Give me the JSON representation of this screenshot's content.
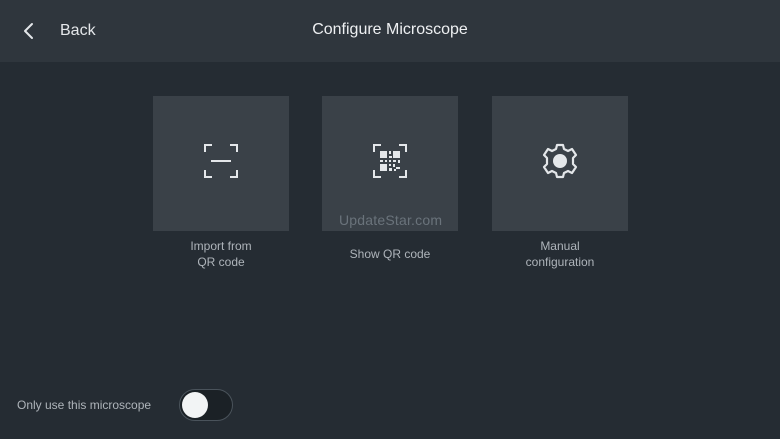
{
  "header": {
    "back_label": "Back",
    "title": "Configure Microscope",
    "back_icon": "chevron-left-icon"
  },
  "options": [
    {
      "label_line1": "Import from",
      "label_line2": "QR code",
      "icon": "scan-frame-icon"
    },
    {
      "label_line1": "Show QR code",
      "label_line2": "",
      "icon": "qr-code-icon"
    },
    {
      "label_line1": "Manual",
      "label_line2": "configuration",
      "icon": "gear-icon"
    }
  ],
  "watermark": "UpdateStar.com",
  "footer": {
    "toggle_label": "Only use this microscope",
    "toggle_on": false
  },
  "colors": {
    "background": "#252c33",
    "header": "#2f363d",
    "tile": "#3a4148",
    "text": "#eef0f2",
    "caption": "#aeb4ba"
  }
}
